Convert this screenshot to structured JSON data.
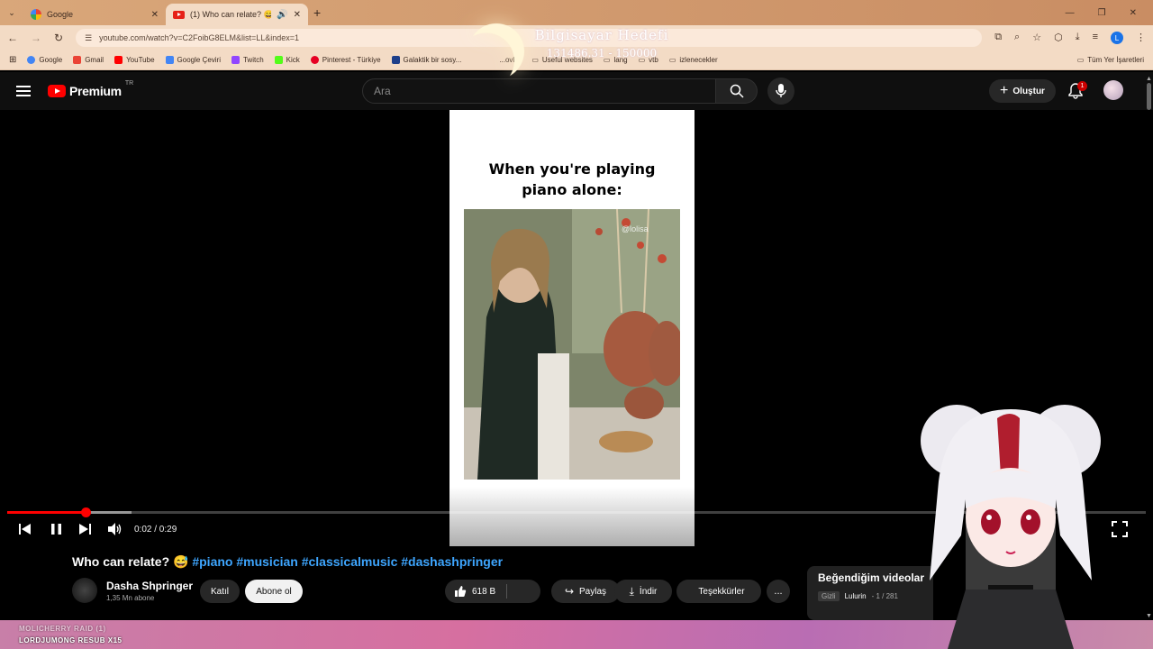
{
  "browser": {
    "tabs": [
      {
        "title": "Google",
        "active": false
      },
      {
        "title": "(1) Who can relate? 😅 #pi",
        "active": true
      }
    ],
    "url": "youtube.com/watch?v=C2FoibG8ELM&list=LL&index=1",
    "profile_letter": "L",
    "bookmarks": [
      "Google",
      "Gmail",
      "YouTube",
      "Google Çeviri",
      "Twitch",
      "Kick",
      "Pinterest - Türkiye",
      "Galaktik bir sosy...",
      "...ovlar",
      "Useful websites",
      "lang",
      "vtb",
      "izlenecekler"
    ],
    "all_bookmarks": "Tüm Yer İşaretleri"
  },
  "overlay": {
    "goal_title": "Bilgisayar Hedefi",
    "goal_progress": "131486.31 - 150000",
    "goal_current": 131486.31,
    "goal_target": 150000
  },
  "youtube": {
    "logo": "Premium",
    "country": "TR",
    "search_placeholder": "Ara",
    "create_label": "Oluştur",
    "notification_count": "1"
  },
  "video": {
    "caption_line1": "When you're playing",
    "caption_line2": "piano alone:",
    "watermark": "@lolisa",
    "time": "0:02 / 0:29",
    "progress_fraction": 0.069,
    "buffered_fraction": 0.109,
    "title": "Who can relate? 😅",
    "hashtags": "#piano #musician #classicalmusic #dashashpringer",
    "channel": "Dasha Shpringer",
    "subscribers": "1,35 Mn abone",
    "join_label": "Katıl",
    "subscribe_label": "Abone ol",
    "likes": "618 B",
    "share_label": "Paylaş",
    "download_label": "İndir",
    "thanks_label": "Teşekkürler",
    "more_label": "..."
  },
  "playlist": {
    "title": "Beğendiğim videolar",
    "privacy": "Gizli",
    "owner": "Lulurin",
    "position": "- 1 / 281"
  },
  "stream_footer": {
    "line1": "MOLICHERRY RAID (1)",
    "line2": "LORDJUMONG RESUB X15"
  },
  "colors": {
    "accent": "#ff0000",
    "hashtag": "#3ea6ff",
    "footer": "#d66fa0"
  }
}
